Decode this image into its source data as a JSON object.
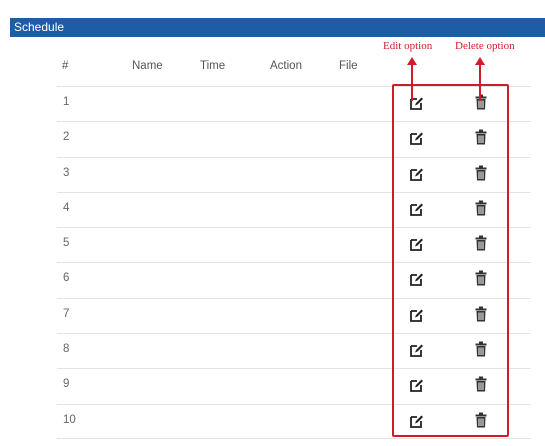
{
  "panel": {
    "title": "Schedule"
  },
  "table": {
    "headers": [
      "#",
      "Name",
      "Time",
      "Action",
      "File"
    ],
    "rows": [
      {
        "num": "1"
      },
      {
        "num": "2"
      },
      {
        "num": "3"
      },
      {
        "num": "4"
      },
      {
        "num": "5"
      },
      {
        "num": "6"
      },
      {
        "num": "7"
      },
      {
        "num": "8"
      },
      {
        "num": "9"
      },
      {
        "num": "10"
      }
    ]
  },
  "annotations": {
    "edit_label": "Edit option",
    "delete_label": "Delete option",
    "color": "#d11a2a"
  },
  "icons": {
    "edit": "edit-icon",
    "delete": "trash-icon"
  },
  "colors": {
    "header_bar": "#1e5ca4"
  }
}
